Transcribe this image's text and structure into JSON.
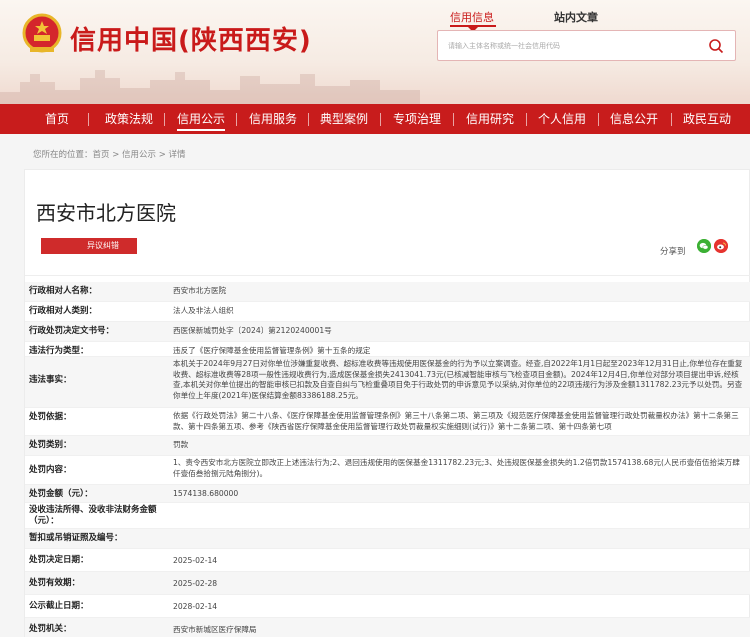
{
  "header": {
    "site_title": "信用中国(陕西西安)",
    "search_tabs": [
      "信用信息",
      "站内文章"
    ],
    "search_placeholder": "请输入主体名称或统一社会信用代码"
  },
  "nav": [
    "首页",
    "政策法规",
    "信用公示",
    "信用服务",
    "典型案例",
    "专项治理",
    "信用研究",
    "个人信用",
    "信息公开",
    "政民互动"
  ],
  "nav_active": "信用公示",
  "breadcrumb": "您所在的位置：首页 >  信用公示 >  详情",
  "title": "西安市北方医院",
  "objection_label": "异议纠错",
  "share_label": "分享到",
  "colors": {
    "brand_red": "#c81c1c",
    "wechat": "#3cb034",
    "weibo": "#e6342f"
  },
  "rows": [
    {
      "label": "行政相对人名称：",
      "value": "西安市北方医院"
    },
    {
      "label": "行政相对人类别：",
      "value": "法人及非法人组织"
    },
    {
      "label": "行政处罚决定文书号：",
      "value": "西医保新城罚处字〔2024〕第2120240001号"
    },
    {
      "label": "违法行为类型：",
      "value": "违反了《医疗保障基金使用监督管理条例》第十五条的规定"
    },
    {
      "label": "违法事实：",
      "value": "本机关于2024年9月27日对你单位涉嫌重复收费、超标准收费等违规使用医保基金的行为予以立案调查。经查,自2022年1月1日起至2023年12月31日止,你单位存在重复收费、超标准收费等28项一般性违规收费行为,造成医保基金损失2413041.73元(已核减智能审核与飞检查项目金额)。2024年12月4日,你单位对部分项目提出申诉,经核查,本机关对你单位提出的智能审核已扣款及自查自纠与飞检重叠项目免于行政处罚的申诉意见予以采纳,对你单位的22项违规行为涉及金额1311782.23元予以处罚。另查你单位上年度(2021年)医保结算金额83386188.25元。"
    },
    {
      "label": "处罚依据：",
      "value": "依据《行政处罚法》第二十八条、《医疗保障基金使用监督管理条例》第三十八条第二项、第三项及《规范医疗保障基金使用监督管理行政处罚裁量权办法》第十二条第三款、第十四条第五项、参考《陕西省医疗保障基金使用监督管理行政处罚裁量权实施细则(试行)》第十二条第二项、第十四条第七项"
    },
    {
      "label": "处罚类别：",
      "value": "罚款"
    },
    {
      "label": "处罚内容：",
      "value": "1、责令西安市北方医院立即改正上述违法行为;2、退回违规使用的医保基金1311782.23元;3、处违规医保基金损失的1.2倍罚款1574138.68元(人民币壹佰伍拾柒万肆仟壹佰叁拾捌元陆角捌分)。"
    },
    {
      "label": "处罚金额（元）：",
      "value": "1574138.680000"
    },
    {
      "label": "没收违法所得、没收非法财务金额（元）：",
      "value": ""
    },
    {
      "label": "暂扣或吊销证照及编号：",
      "value": ""
    },
    {
      "label": "处罚决定日期：",
      "value": "2025-02-14"
    },
    {
      "label": "处罚有效期：",
      "value": "2025-02-28"
    },
    {
      "label": "公示截止日期：",
      "value": "2028-02-14"
    },
    {
      "label": "处罚机关：",
      "value": "西安市新城区医疗保障局"
    }
  ]
}
